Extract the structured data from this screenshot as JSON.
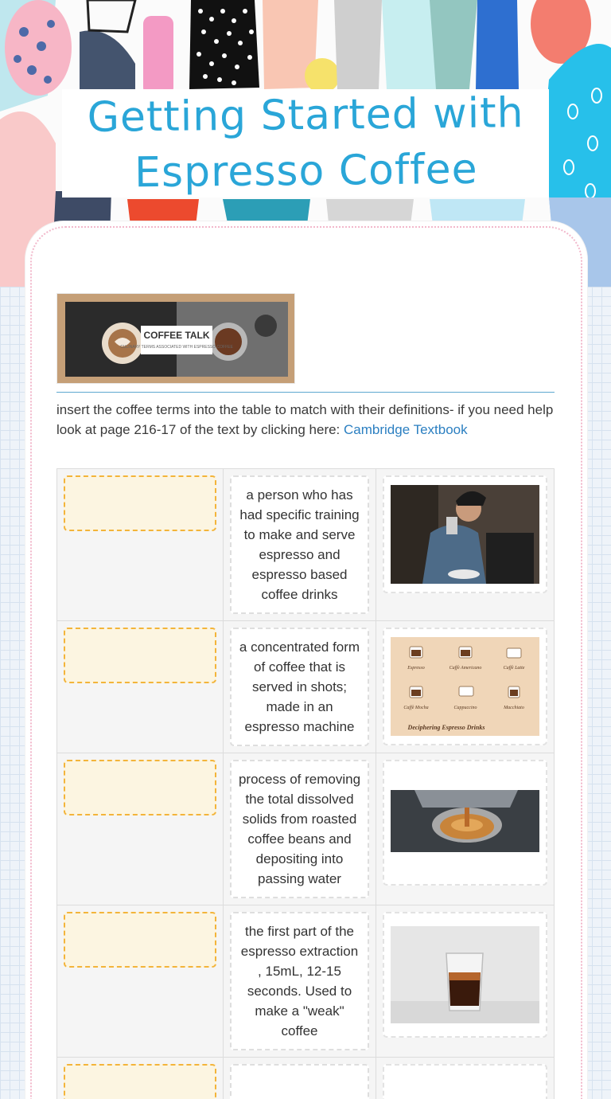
{
  "header": {
    "title_line1": "Getting Started with",
    "title_line2": "Espresso Coffee"
  },
  "banner": {
    "heading": "COFFEE TALK",
    "subheading": "CULINARY TERMS ASSOCIATED WITH ESPRESSO COFFEE"
  },
  "instructions": {
    "text": "insert the coffee terms into the table to match with their definitions- if you need help look at page 216-17 of the text by clicking here: ",
    "link_label": "Cambridge Textbook"
  },
  "rows": [
    {
      "definition": "a person who has had specific training to make and serve espresso and espresso based coffee drinks",
      "image_icon": "barista-photo"
    },
    {
      "definition": "a concentrated form of coffee that is served in shots; made in an espresso machine",
      "image_icon": "espresso-drinks-chart",
      "chart_labels": [
        "Espresso",
        "Caffè Americano",
        "Caffè Latte",
        "Caffè Mocha",
        "Cappuccino",
        "Macchiato"
      ],
      "chart_caption": "Deciphering Espresso Drinks"
    },
    {
      "definition": "process of removing the total dissolved solids from roasted coffee beans and depositing into passing water",
      "image_icon": "espresso-extraction-photo"
    },
    {
      "definition": "the first part of the espresso extraction , 15mL, 12-15 seconds. Used to make a \"weak\" coffee",
      "image_icon": "ristretto-shot-glass-photo"
    },
    {
      "definition": "",
      "image_icon": "partial-image"
    }
  ],
  "colors": {
    "title": "#2aa6d8",
    "drop_zone_border": "#f3b43a",
    "drop_zone_fill": "#fcf5e1",
    "link": "#2b7fc1"
  }
}
